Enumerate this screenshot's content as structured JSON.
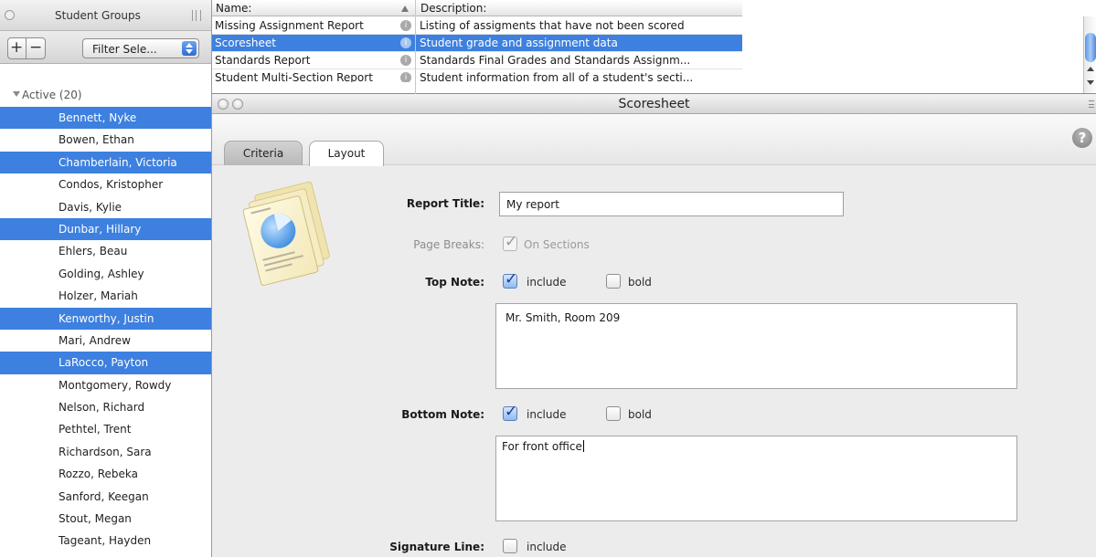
{
  "sidebar": {
    "title": "Student Groups",
    "plus": "+",
    "minus": "−",
    "filter_select": "Filter Sele...",
    "group_label": "Active (20)",
    "students": [
      {
        "name": "Bennett, Nyke",
        "selected": true
      },
      {
        "name": "Bowen, Ethan",
        "selected": false
      },
      {
        "name": "Chamberlain, Victoria",
        "selected": true
      },
      {
        "name": "Condos, Kristopher",
        "selected": false
      },
      {
        "name": "Davis, Kylie",
        "selected": false
      },
      {
        "name": "Dunbar, Hillary",
        "selected": true
      },
      {
        "name": "Ehlers, Beau",
        "selected": false
      },
      {
        "name": "Golding, Ashley",
        "selected": false
      },
      {
        "name": "Holzer, Mariah",
        "selected": false
      },
      {
        "name": "Kenworthy, Justin",
        "selected": true
      },
      {
        "name": "Mari, Andrew",
        "selected": false
      },
      {
        "name": "LaRocco, Payton",
        "selected": true
      },
      {
        "name": "Montgomery, Rowdy",
        "selected": false
      },
      {
        "name": "Nelson, Richard",
        "selected": false
      },
      {
        "name": "Pethtel, Trent",
        "selected": false
      },
      {
        "name": "Richardson, Sara",
        "selected": false
      },
      {
        "name": "Rozzo, Rebeka",
        "selected": false
      },
      {
        "name": "Sanford, Keegan",
        "selected": false
      },
      {
        "name": "Stout, Megan",
        "selected": false
      },
      {
        "name": "Tageant, Hayden",
        "selected": false
      }
    ]
  },
  "reports": {
    "col_name": "Name:",
    "col_description": "Description:",
    "rows": [
      {
        "name": "Missing Assignment Report",
        "description": "Listing of assigments that have not been scored",
        "selected": false
      },
      {
        "name": "Scoresheet",
        "description": "Student grade and assignment data",
        "selected": true
      },
      {
        "name": "Standards Report",
        "description": "Standards Final Grades and Standards Assignm...",
        "selected": false
      },
      {
        "name": "Student Multi-Section Report",
        "description": "Student information from all of a student's secti...",
        "selected": false
      }
    ]
  },
  "panel": {
    "title": "Scoresheet",
    "help": "?",
    "tabs": {
      "criteria": "Criteria",
      "layout": "Layout"
    },
    "form": {
      "report_title_label": "Report Title:",
      "report_title_value": "My report",
      "page_breaks_label": "Page Breaks:",
      "page_breaks_option": "On Sections",
      "top_note_label": "Top Note:",
      "top_note_include": "include",
      "top_note_bold": "bold",
      "top_note_text": "Mr. Smith, Room 209",
      "bottom_note_label": "Bottom Note:",
      "bottom_note_include": "include",
      "bottom_note_bold": "bold",
      "bottom_note_text": "For front office",
      "signature_line_label": "Signature Line:",
      "signature_line_include": "include"
    }
  }
}
